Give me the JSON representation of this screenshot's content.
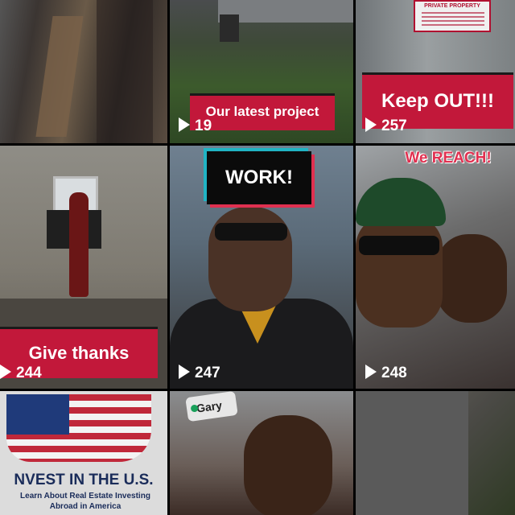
{
  "tiles": [
    {
      "caption": "",
      "views": ""
    },
    {
      "caption": "Our latest project",
      "views": "19"
    },
    {
      "caption": "Keep OUT!!!",
      "views": "257",
      "sign_title": "PRIVATE PROPERTY"
    },
    {
      "caption": "Give thanks",
      "views": "244"
    },
    {
      "caption": "WORK!",
      "views": "247"
    },
    {
      "caption": "We REACH!",
      "views": "248"
    },
    {
      "title": "NVEST IN THE U.S.",
      "subtitle": "Learn About Real Estate Investing Abroad in America"
    },
    {
      "tag": "Gary"
    },
    {
      "caption": ""
    }
  ],
  "colors": {
    "banner": "#c2183a",
    "text": "#ffffff",
    "work_bg": "#0b0b0b"
  }
}
